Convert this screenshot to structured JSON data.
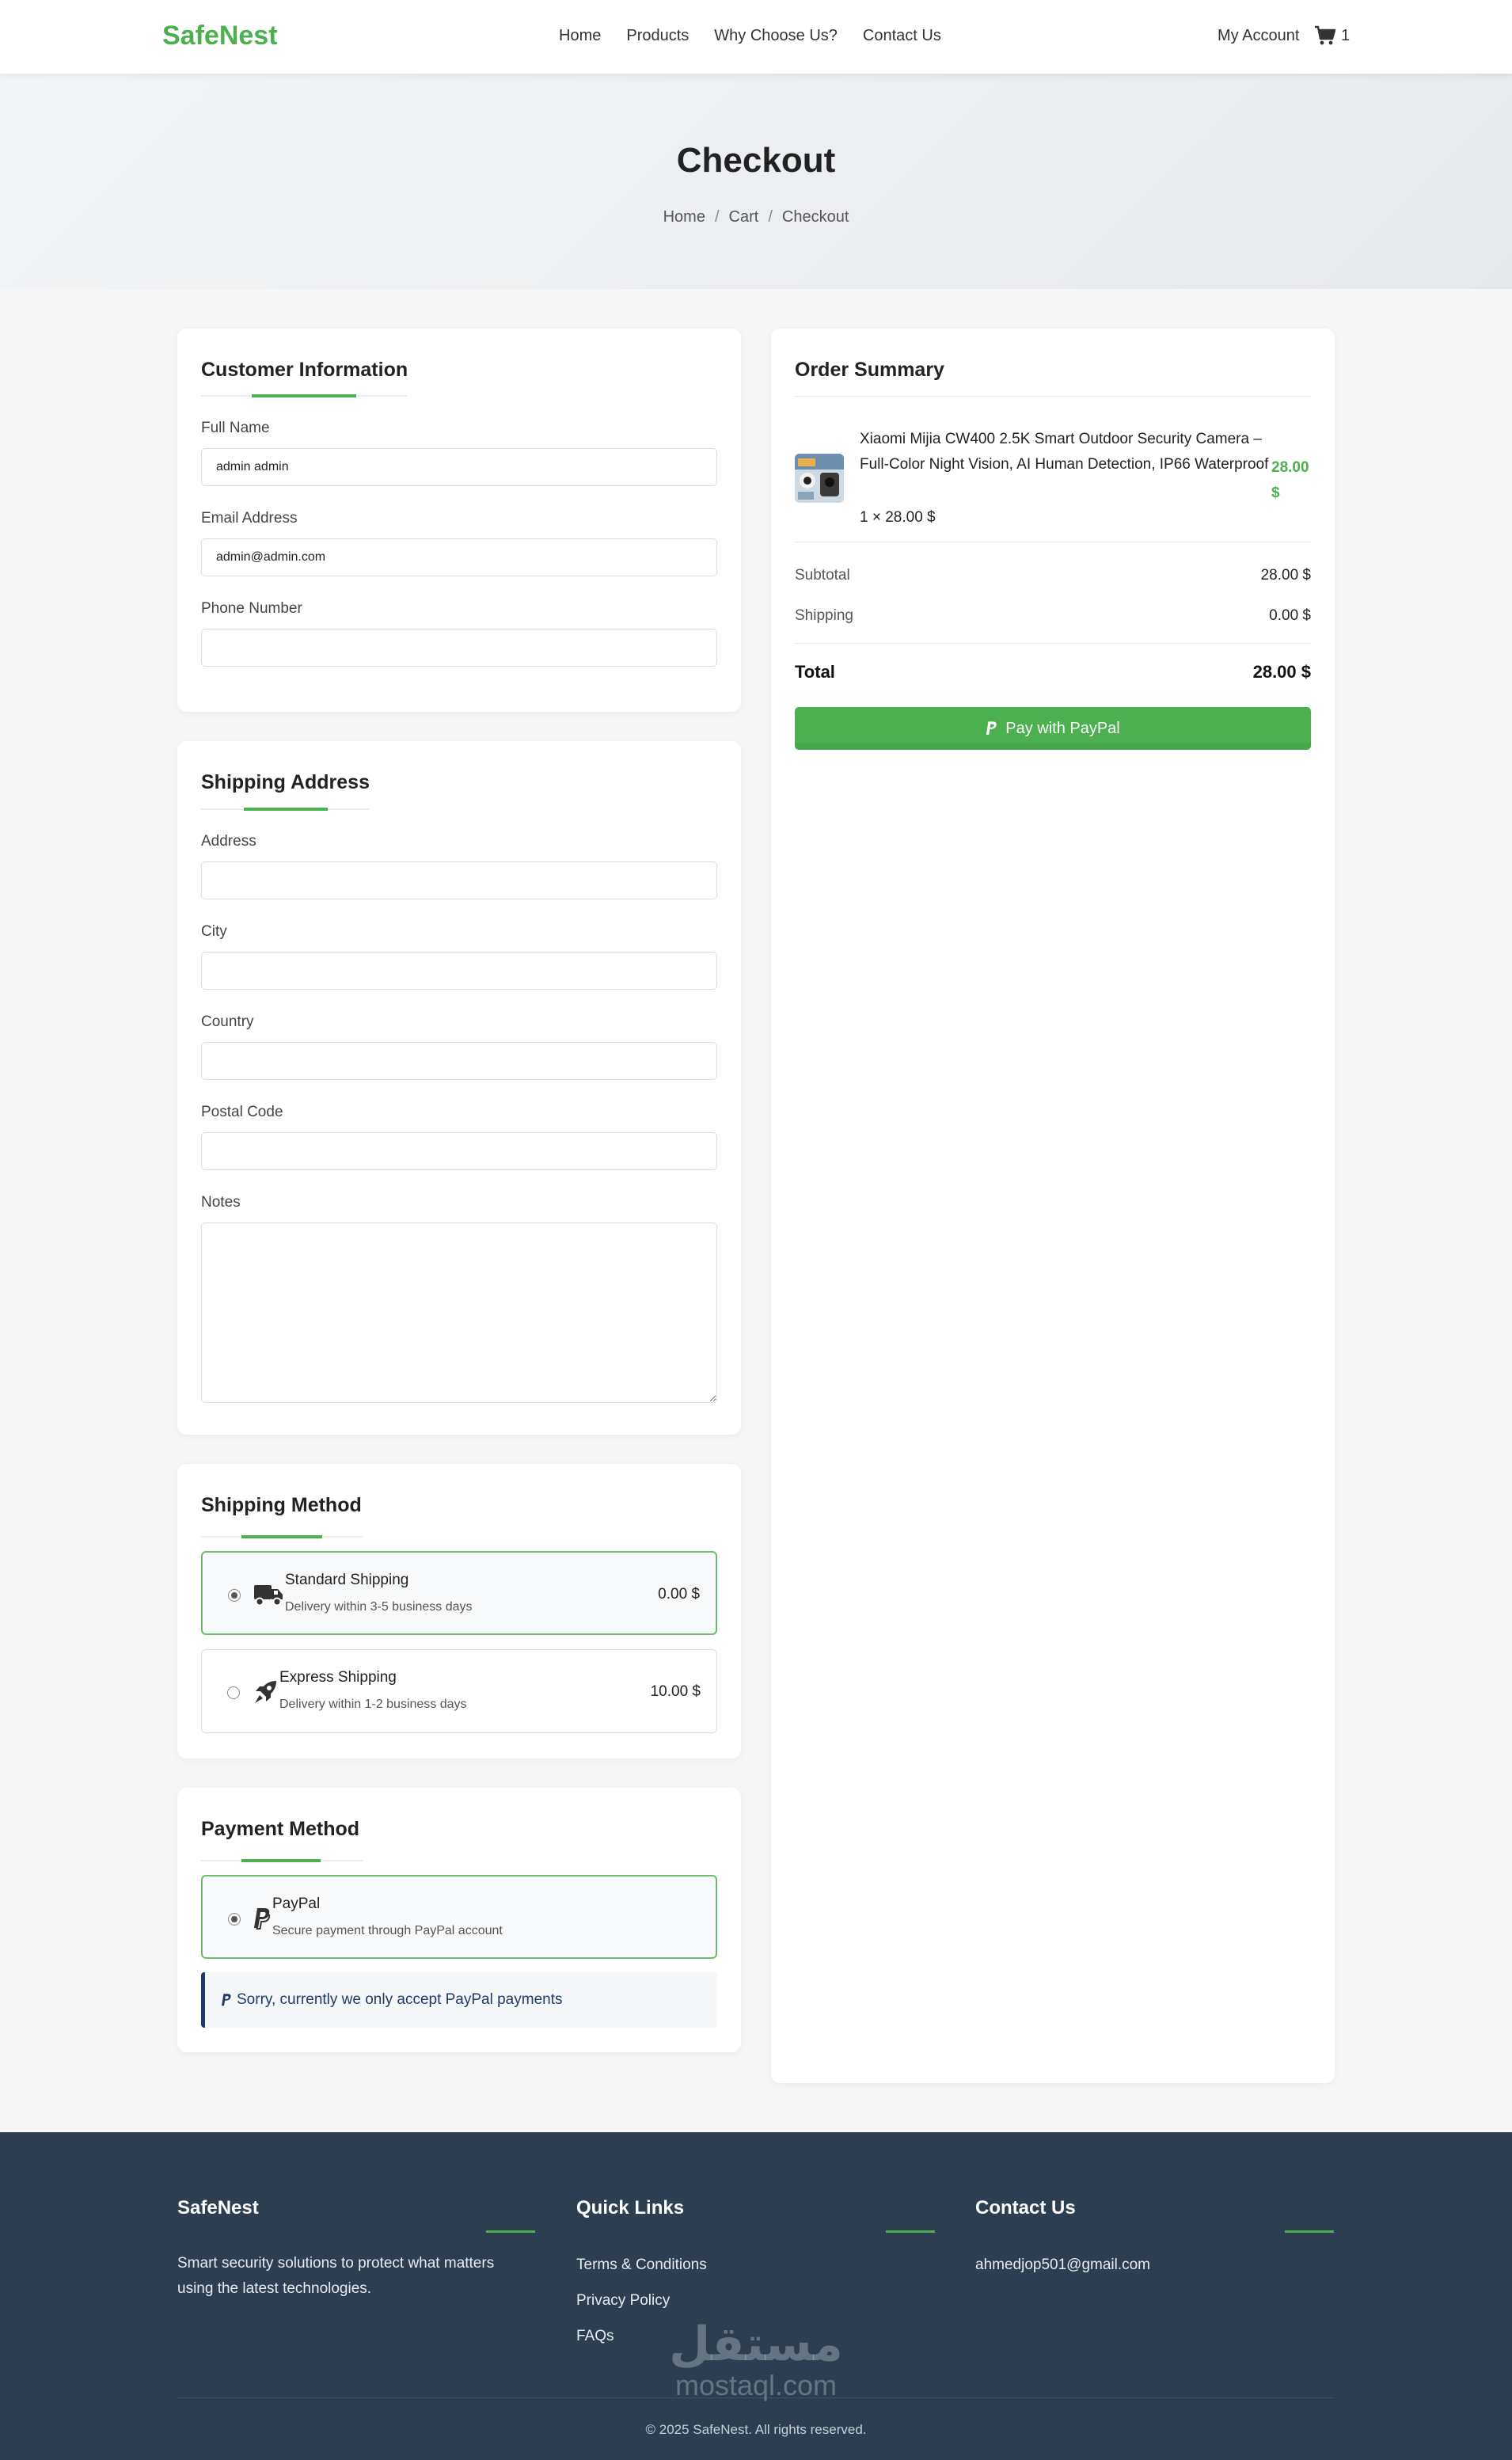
{
  "brand": {
    "name": "SafeNest",
    "accent": "#4caf50"
  },
  "nav": {
    "items": [
      "Home",
      "Products",
      "Why Choose Us?",
      "Contact Us"
    ],
    "account": "My Account",
    "cart_count": "1"
  },
  "hero": {
    "title": "Checkout",
    "breadcrumb": [
      "Home",
      "Cart",
      "Checkout"
    ],
    "separator": "/"
  },
  "customer": {
    "title": "Customer Information",
    "full_name_label": "Full Name",
    "full_name_value": "admin admin",
    "email_label": "Email Address",
    "email_value": "admin@admin.com",
    "phone_label": "Phone Number",
    "phone_value": ""
  },
  "shipping_address": {
    "title": "Shipping Address",
    "address_label": "Address",
    "city_label": "City",
    "country_label": "Country",
    "postal_label": "Postal Code",
    "notes_label": "Notes"
  },
  "shipping_method": {
    "title": "Shipping Method",
    "options": [
      {
        "title": "Standard Shipping",
        "desc": "Delivery within 3-5 business days",
        "price": "0.00 $",
        "selected": true,
        "icon": "truck-icon"
      },
      {
        "title": "Express Shipping",
        "desc": "Delivery within 1-2 business days",
        "price": "10.00 $",
        "selected": false,
        "icon": "rocket-icon"
      }
    ]
  },
  "payment_method": {
    "title": "Payment Method",
    "option_title": "PayPal",
    "option_desc": "Secure payment through PayPal account",
    "notice": "Sorry, currently we only accept PayPal payments"
  },
  "order": {
    "title": "Order Summary",
    "item_name": "Xiaomi Mijia CW400 2.5K Smart Outdoor Security Camera – Full-Color Night Vision, AI Human Detection, IP66 Waterproof",
    "item_qty": "1 × 28.00 $",
    "item_price": "28.00 $",
    "subtotal_label": "Subtotal",
    "subtotal_value": "28.00 $",
    "shipping_label": "Shipping",
    "shipping_value": "0.00 $",
    "total_label": "Total",
    "total_value": "28.00 $",
    "pay_button": "Pay with PayPal"
  },
  "footer": {
    "brand_title": "SafeNest",
    "brand_text": "Smart security solutions to protect what matters using the latest technologies.",
    "links_title": "Quick Links",
    "links": [
      "Terms & Conditions",
      "Privacy Policy",
      "FAQs"
    ],
    "contact_title": "Contact Us",
    "contact_email": "ahmedjop501@gmail.com",
    "copyright": "© 2025 SafeNest. All rights reserved.",
    "watermark_ar": "مستقل",
    "watermark_en": "mostaql.com"
  }
}
